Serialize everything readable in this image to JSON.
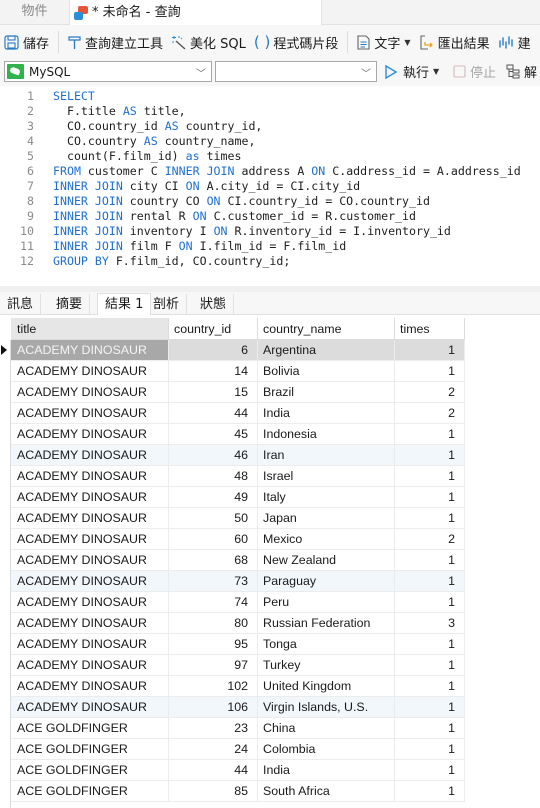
{
  "tabs": {
    "objects_label": "物件",
    "query_label": "* 未命名 - 查詢"
  },
  "toolbar": {
    "save": "儲存",
    "query_builder": "查詢建立工具",
    "beautify": "美化 SQL",
    "snippet": "程式碼片段",
    "text": "文字",
    "export": "匯出結果",
    "visual_partial": "建"
  },
  "connection": {
    "selected_connection": "MySQL",
    "selected_database": "",
    "run": "執行",
    "stop": "停止",
    "explain": "解"
  },
  "editor": {
    "lines": [
      {
        "n": "1",
        "parts": [
          {
            "t": "SELECT",
            "k": true
          }
        ]
      },
      {
        "n": "2",
        "parts": [
          {
            "t": "  F.title "
          },
          {
            "t": "AS",
            "k": true
          },
          {
            "t": " title,"
          }
        ]
      },
      {
        "n": "3",
        "parts": [
          {
            "t": "  CO.country_id "
          },
          {
            "t": "AS",
            "k": true
          },
          {
            "t": " country_id,"
          }
        ]
      },
      {
        "n": "4",
        "parts": [
          {
            "t": "  CO.country "
          },
          {
            "t": "AS",
            "k": true
          },
          {
            "t": " country_name,"
          }
        ]
      },
      {
        "n": "5",
        "parts": [
          {
            "t": "  count(F.film_id) "
          },
          {
            "t": "as",
            "k": true
          },
          {
            "t": " times"
          }
        ]
      },
      {
        "n": "6",
        "parts": [
          {
            "t": "FROM",
            "k": true
          },
          {
            "t": " customer C "
          },
          {
            "t": "INNER JOIN",
            "k": true
          },
          {
            "t": " address A "
          },
          {
            "t": "ON",
            "k": true
          },
          {
            "t": " C.address_id = A.address_id"
          }
        ]
      },
      {
        "n": "7",
        "parts": [
          {
            "t": "INNER JOIN",
            "k": true
          },
          {
            "t": " city CI "
          },
          {
            "t": "ON",
            "k": true
          },
          {
            "t": " A.city_id = CI.city_id"
          }
        ]
      },
      {
        "n": "8",
        "parts": [
          {
            "t": "INNER JOIN",
            "k": true
          },
          {
            "t": " country CO "
          },
          {
            "t": "ON",
            "k": true
          },
          {
            "t": " CI.country_id = CO.country_id"
          }
        ]
      },
      {
        "n": "9",
        "parts": [
          {
            "t": "INNER JOIN",
            "k": true
          },
          {
            "t": " rental R "
          },
          {
            "t": "ON",
            "k": true
          },
          {
            "t": " C.customer_id = R.customer_id"
          }
        ]
      },
      {
        "n": "10",
        "parts": [
          {
            "t": "INNER JOIN",
            "k": true
          },
          {
            "t": " inventory I "
          },
          {
            "t": "ON",
            "k": true
          },
          {
            "t": " R.inventory_id = I.inventory_id"
          }
        ]
      },
      {
        "n": "11",
        "parts": [
          {
            "t": "INNER JOIN",
            "k": true
          },
          {
            "t": " film F "
          },
          {
            "t": "ON",
            "k": true
          },
          {
            "t": " I.film_id = F.film_id"
          }
        ]
      },
      {
        "n": "12",
        "parts": [
          {
            "t": "GROUP BY",
            "k": true
          },
          {
            "t": " F.film_id, CO.country_id;"
          }
        ]
      }
    ]
  },
  "result_tabs": [
    "訊息",
    "摘要",
    "結果 1",
    "剖析",
    "狀態"
  ],
  "active_result_tab": "結果 1",
  "grid": {
    "columns": [
      "title",
      "country_id",
      "country_name",
      "times"
    ],
    "rows": [
      [
        "ACADEMY DINOSAUR",
        "6",
        "Argentina",
        "1"
      ],
      [
        "ACADEMY DINOSAUR",
        "14",
        "Bolivia",
        "1"
      ],
      [
        "ACADEMY DINOSAUR",
        "15",
        "Brazil",
        "2"
      ],
      [
        "ACADEMY DINOSAUR",
        "44",
        "India",
        "2"
      ],
      [
        "ACADEMY DINOSAUR",
        "45",
        "Indonesia",
        "1"
      ],
      [
        "ACADEMY DINOSAUR",
        "46",
        "Iran",
        "1"
      ],
      [
        "ACADEMY DINOSAUR",
        "48",
        "Israel",
        "1"
      ],
      [
        "ACADEMY DINOSAUR",
        "49",
        "Italy",
        "1"
      ],
      [
        "ACADEMY DINOSAUR",
        "50",
        "Japan",
        "1"
      ],
      [
        "ACADEMY DINOSAUR",
        "60",
        "Mexico",
        "2"
      ],
      [
        "ACADEMY DINOSAUR",
        "68",
        "New Zealand",
        "1"
      ],
      [
        "ACADEMY DINOSAUR",
        "73",
        "Paraguay",
        "1"
      ],
      [
        "ACADEMY DINOSAUR",
        "74",
        "Peru",
        "1"
      ],
      [
        "ACADEMY DINOSAUR",
        "80",
        "Russian Federation",
        "3"
      ],
      [
        "ACADEMY DINOSAUR",
        "95",
        "Tonga",
        "1"
      ],
      [
        "ACADEMY DINOSAUR",
        "97",
        "Turkey",
        "1"
      ],
      [
        "ACADEMY DINOSAUR",
        "102",
        "United Kingdom",
        "1"
      ],
      [
        "ACADEMY DINOSAUR",
        "106",
        "Virgin Islands, U.S.",
        "1"
      ],
      [
        "ACE GOLDFINGER",
        "23",
        "China",
        "1"
      ],
      [
        "ACE GOLDFINGER",
        "24",
        "Colombia",
        "1"
      ],
      [
        "ACE GOLDFINGER",
        "44",
        "India",
        "1"
      ],
      [
        "ACE GOLDFINGER",
        "85",
        "South Africa",
        "1"
      ]
    ],
    "selected_row": 0
  },
  "colors": {
    "keyword": "#1f6fd1",
    "run_accent": "#2a8fd8",
    "export_accent": "#f0a020",
    "mysql_green": "#2fb34a"
  }
}
